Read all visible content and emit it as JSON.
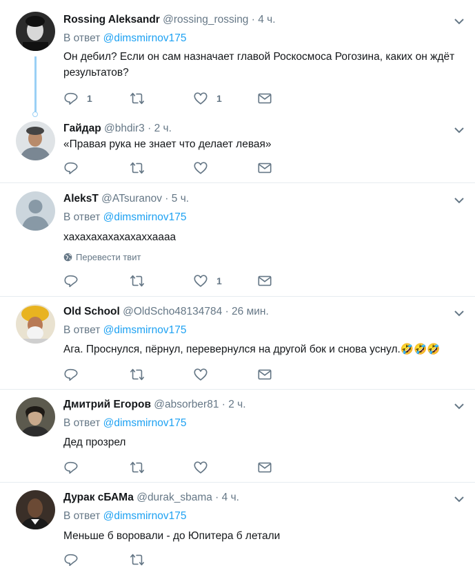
{
  "reply_prefix": "В ответ",
  "translate_label": "Перевести твит",
  "emoji": "🤣🤣🤣",
  "tweets": [
    {
      "name": "Rossing Aleksandr",
      "handle": "@rossing_rossing",
      "time": "· 4 ч.",
      "reply_to": "@dimsmirnov175",
      "text": "Он дебил? Если он сам назначает главой Роскосмоса Рогозина, каких он ждёт результатов?",
      "replies": "1",
      "retweets": "",
      "likes": "1"
    },
    {
      "name": "Гайдар",
      "handle": "@bhdir3",
      "time": "· 2 ч.",
      "reply_to": "",
      "text": "«Правая рука не знает что делает левая»",
      "replies": "",
      "retweets": "",
      "likes": ""
    },
    {
      "name": "AleksT",
      "handle": "@ATsuranov",
      "time": "· 5 ч.",
      "reply_to": "@dimsmirnov175",
      "text": "хахахахахахахаххаааа",
      "replies": "",
      "retweets": "",
      "likes": "1"
    },
    {
      "name": "Old School",
      "handle": "@OldScho48134784",
      "time": "· 26 мин.",
      "reply_to": "@dimsmirnov175",
      "text": "Ага. Проснулся, пёрнул, перевернулся на другой бок и снова уснул.",
      "replies": "",
      "retweets": "",
      "likes": ""
    },
    {
      "name": "Дмитрий Егоров",
      "handle": "@absorber81",
      "time": "· 2 ч.",
      "reply_to": "@dimsmirnov175",
      "text": "Дед прозрел",
      "replies": "",
      "retweets": "",
      "likes": ""
    },
    {
      "name": "Дурак сБАМа",
      "handle": "@durak_sbama",
      "time": "· 4 ч.",
      "reply_to": "@dimsmirnov175",
      "text": "Меньше б воровали - до Юпитера б летали",
      "replies": "",
      "retweets": "",
      "likes": ""
    }
  ]
}
